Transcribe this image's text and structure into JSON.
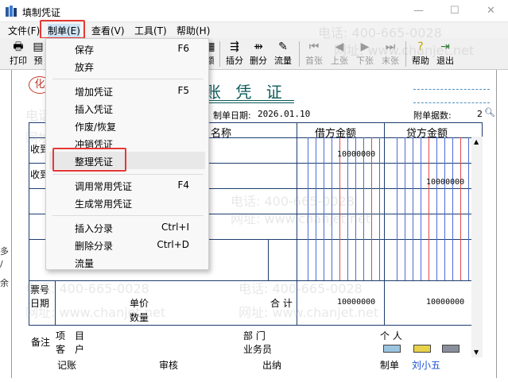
{
  "window": {
    "title": "填制凭证",
    "min_glyph": "—",
    "max_glyph": "☐",
    "close_glyph": "✕"
  },
  "menubar": [
    {
      "label": "文件(F)"
    },
    {
      "label": "制单(E)"
    },
    {
      "label": "查看(V)"
    },
    {
      "label": "工具(T)"
    },
    {
      "label": "帮助(H)"
    }
  ],
  "toolbar": {
    "print": "打印",
    "preview": "预",
    "partial_right": "额",
    "insert_entry": "插分",
    "delete_entry": "删分",
    "flow": "流量",
    "first": "首张",
    "prev": "上张",
    "next": "下张",
    "last": "末张",
    "help": "帮助",
    "exit": "退出"
  },
  "dropdown": {
    "items": [
      {
        "label": "保存",
        "key": "F6"
      },
      {
        "label": "放弃",
        "key": ""
      },
      {
        "label": "增加凭证",
        "key": "F5"
      },
      {
        "label": "插入凭证",
        "key": ""
      },
      {
        "label": "作废/恢复",
        "key": ""
      },
      {
        "label": "冲销凭证",
        "key": ""
      },
      {
        "label": "整理凭证",
        "key": ""
      },
      {
        "label": "调用常用凭证",
        "key": "F4"
      },
      {
        "label": "生成常用凭证",
        "key": ""
      },
      {
        "label": "插入分录",
        "key": "Ctrl+I"
      },
      {
        "label": "删除分录",
        "key": "Ctrl+D"
      },
      {
        "label": "流量",
        "key": ""
      }
    ]
  },
  "voucher": {
    "title": "账 凭 证",
    "stamp": "化",
    "date_label": "制单日期:",
    "date_value": "2026.01.10",
    "attach_label": "附单据数:",
    "attach_value": "2",
    "header_account": "名称",
    "header_debit": "借方金额",
    "header_credit": "贷方金额",
    "rows": [
      {
        "summary": "收到",
        "debit": "10000000",
        "credit": ""
      },
      {
        "summary": "收到",
        "debit": "",
        "credit": "10000000"
      }
    ],
    "bill_no_label": "票号",
    "date_row_label": "日期",
    "unit_price_label": "单价",
    "quantity_label": "数量",
    "total_label": "合 计",
    "total_debit": "10000000",
    "total_credit": "10000000",
    "remark_label": "备注",
    "project_label": "项",
    "project_label2": "目",
    "customer_label": "客",
    "customer_label2": "户",
    "dept_label": "部 门",
    "person_label": "个 人",
    "salesman_label": "业务员"
  },
  "footer": {
    "bookkeeping": "记账",
    "review": "审核",
    "cashier": "出纳",
    "maker": "制单",
    "maker_name": "刘小五"
  },
  "watermark": {
    "phone": "电话: 400-665-0028",
    "site": "网址: www.chanjet.net"
  },
  "colors": {
    "highlight": "#e53935",
    "title_teal": "#0b5a5a",
    "grid_blue": "#1c3d6e",
    "maker_name": "#1a4fd6"
  }
}
